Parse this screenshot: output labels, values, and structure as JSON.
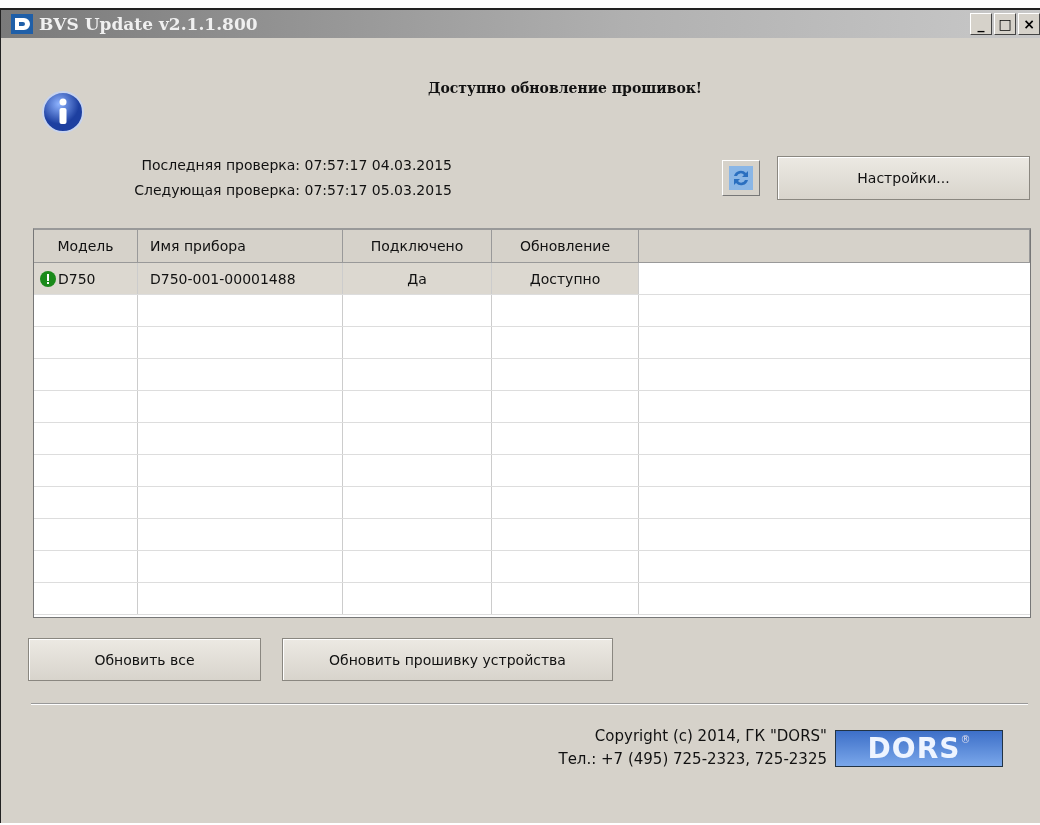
{
  "window": {
    "title": "BVS Update v2.1.1.800",
    "controls": [
      "_",
      "□",
      "×"
    ]
  },
  "message": "Доступно обновление прошивок!",
  "checks": [
    "Последняя проверка: 07:57:17 04.03.2015",
    "Следующая проверка: 07:57:17 05.03.2015"
  ],
  "settings_button": "Настройки...",
  "table": {
    "columns": [
      "Модель",
      "Имя прибора",
      "Подключено",
      "Обновление"
    ],
    "rows": [
      {
        "cells": [
          "D750",
          "D750-001-00001488",
          "Да",
          "Доступно"
        ],
        "selected": true,
        "color": "#1a8a1a"
      }
    ]
  },
  "buttons": [
    "Обновить все",
    "Обновить прошивку устройства"
  ],
  "footer": [
    "Copyright (c) 2014, ГК \"DORS\"",
    "Тел.: +7 (495) 725-2323, 725-2325"
  ],
  "logo": {
    "text": "DORS",
    "mark": "®"
  }
}
